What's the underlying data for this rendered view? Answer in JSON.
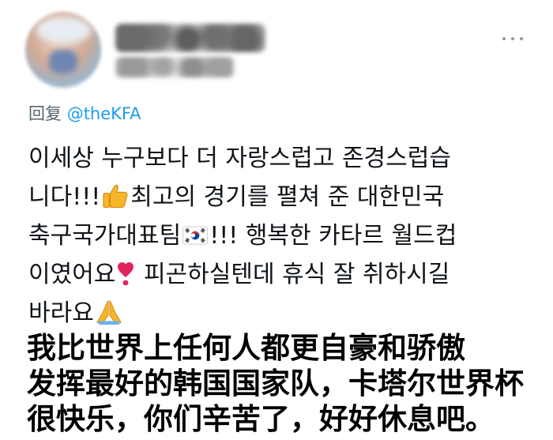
{
  "tweet": {
    "reply_prefix": "回复",
    "reply_mention": "@theKFA",
    "lines": [
      "이세상 누구보다 더 자랑스럽고 존경스럽습",
      "니다!!!",
      "최고의 경기를 펼쳐 준 대한민국",
      "축구국가대표팀",
      "!!! 행복한 카타르 월드컵",
      "이였어요",
      " 피곤하실텐데 휴식 잘 취하시길",
      "바라요"
    ],
    "emojis": [
      "thumbs-up",
      "south-korea-flag",
      "red-heart-exclamation",
      "folded-hands"
    ]
  },
  "caption": {
    "lines": [
      "我比世界上任何人都更自豪和骄傲",
      "发挥最好的韩国国家队，卡塔尔世界杯",
      "很快乐，你们辛苦了，好好休息吧。"
    ]
  },
  "colors": {
    "text": "#0f1419",
    "muted": "#536471",
    "link": "#1d9bf0",
    "caption": "#000000"
  }
}
